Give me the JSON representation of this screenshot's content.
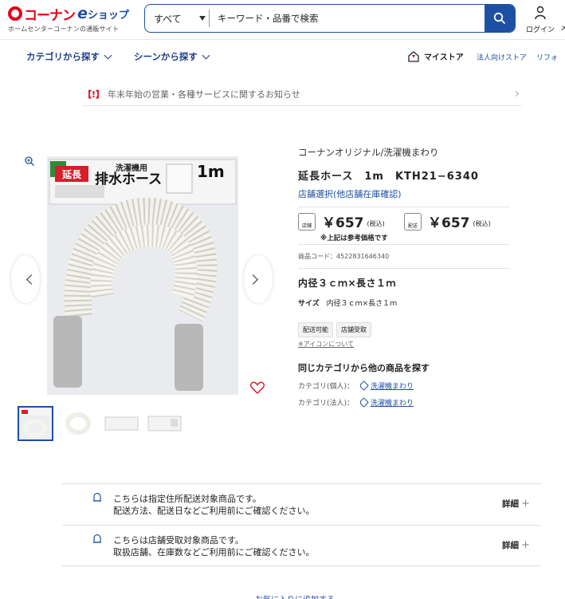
{
  "header": {
    "logo_brand": "コーナン",
    "logo_e": "e",
    "logo_shop": "ショップ",
    "logo_sub": "ホームセンターコーナンの通販サイト",
    "search_category": "すべて",
    "search_placeholder": "キーワード・品番で検索",
    "login_label": "ログイン",
    "cut_text": "メ"
  },
  "nav": {
    "category_label": "カテゴリから探す",
    "scene_label": "シーンから探す",
    "mystore_label": "マイストア",
    "right_links": [
      "法人向けストア",
      "リフォ"
    ]
  },
  "notice": {
    "tag": "【!】",
    "text": "年末年始の営業・各種サービスに関するお知らせ"
  },
  "product": {
    "image_pkg_title": "洗濯機用",
    "image_pkg_name": "排水ホース",
    "image_pkg_badge": "延長",
    "image_pkg_length": "1m",
    "brand": "コーナンオリジナル/洗濯機まわり",
    "title": "延長ホース　1m　KTH21−6340",
    "store_link": "店舗選択(他店舗在庫確認)",
    "price_store_icon": "店舗",
    "price_store": "￥657",
    "price_store_tax": "(税込)",
    "price_delivery_icon": "配送",
    "price_delivery": "￥657",
    "price_delivery_tax": "(税込)",
    "price_note": "※上記は参考価格です",
    "code": "商品コード：4522831646340",
    "spec_title": "内径３ｃｍ×長さ１ｍ",
    "size_label": "サイズ",
    "size_value": "内径３ｃｍ×長さ１ｍ",
    "badges": [
      "配送可能",
      "店舗受取"
    ],
    "icon_about": "※アイコンについて",
    "same_category_title": "同じカテゴリから他の商品を探す",
    "cat_personal_label": "カテゴリ(個人)：",
    "cat_personal_link": "洗濯機まわり",
    "cat_business_label": "カテゴリ(法人)：",
    "cat_business_link": "洗濯機まわり"
  },
  "delivery": [
    {
      "line1": "こちらは指定住所配送対象商品です。",
      "line2": "配送方法、配送日などご利用前にご確認ください。",
      "detail": "詳細"
    },
    {
      "line1": "こちらは店舗受取対象商品です。",
      "line2": "取扱店舗、在庫数などご利用前にご確認ください。",
      "detail": "詳細"
    }
  ],
  "bottom_cut": "お気に入りに追加する",
  "colors": {
    "brand_red": "#e4001b",
    "brand_blue": "#1d50a2"
  }
}
